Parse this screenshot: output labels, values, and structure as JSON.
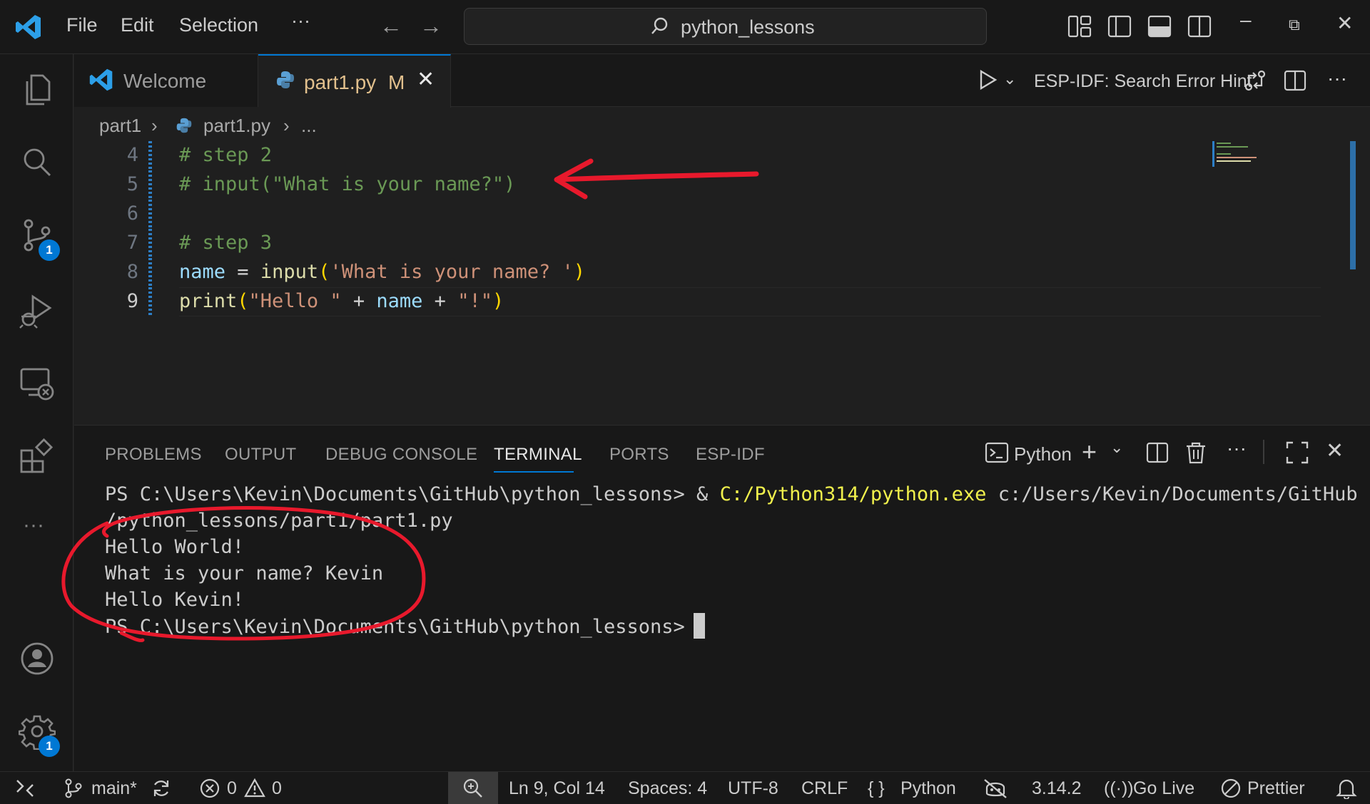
{
  "titlebar": {
    "menu": [
      "File",
      "Edit",
      "Selection",
      "···"
    ],
    "search_text": "python_lessons"
  },
  "activitybar": {
    "source_control_badge": "1",
    "settings_badge": "1",
    "more": "···"
  },
  "tabs": [
    {
      "label": "Welcome"
    },
    {
      "label": "part1.py",
      "status": "M"
    }
  ],
  "tab_actions": {
    "search_error_hint": "ESP-IDF: Search Error Hint",
    "more": "···"
  },
  "breadcrumb": {
    "folder": "part1",
    "file": "part1.py",
    "more": "..."
  },
  "editor": {
    "line_numbers": [
      "4",
      "5",
      "6",
      "7",
      "8",
      "9"
    ],
    "current_line": "9",
    "lines": [
      {
        "comment": "# step 2"
      },
      {
        "comment": "# input(\"What is your name?\")"
      },
      {},
      {
        "comment": "# step 3"
      },
      {
        "var": "name",
        "eq": " = ",
        "func": "input",
        "open": "(",
        "str": "'What is your name? '",
        "close": ")"
      },
      {
        "func": "print",
        "open": "(",
        "str1": "\"Hello \"",
        "plus1": " + ",
        "var": "name",
        "plus2": " + ",
        "str2": "\"!\"",
        "close": ")"
      }
    ]
  },
  "panel": {
    "tabs": [
      "PROBLEMS",
      "OUTPUT",
      "DEBUG CONSOLE",
      "TERMINAL",
      "PORTS",
      "ESP-IDF"
    ],
    "active_tab": "TERMINAL",
    "shell": "Python",
    "more": "···",
    "terminal": {
      "prompt": "PS C:\\Users\\Kevin\\Documents\\GitHub\\python_lessons>",
      "amp": " & ",
      "exe": "C:/Python314/python.exe",
      "arg1": " c:/Users/Kevin/Documents/GitHub",
      "arg2": "/python_lessons/part1/part1.py",
      "out1": "Hello World!",
      "out2": "What is your name? Kevin",
      "out3": "Hello Kevin!",
      "prompt2": "PS C:\\Users\\Kevin\\Documents\\GitHub\\python_lessons>"
    }
  },
  "statusbar": {
    "branch": "main*",
    "errors": "0",
    "warnings": "0",
    "position": "Ln 9, Col 14",
    "spaces": "Spaces: 4",
    "encoding": "UTF-8",
    "eol": "CRLF",
    "language_braces": "{ }",
    "language": "Python",
    "version": "3.14.2",
    "go_live": "Go Live",
    "prettier": "Prettier"
  },
  "colors": {
    "accent": "#0078d4",
    "annotation_red": "#e8192c",
    "comment": "#6a9955",
    "string": "#ce9178",
    "function": "#dcdcaa",
    "variable": "#9cdcfe"
  }
}
